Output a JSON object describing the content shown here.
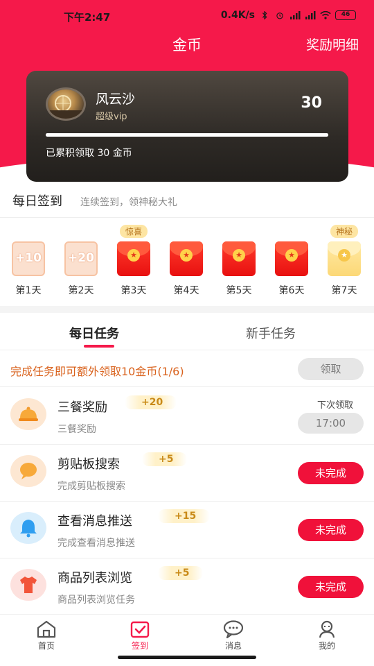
{
  "status_bar": {
    "time": "下午2:47",
    "speed": "0.4K/s",
    "battery": "46"
  },
  "header": {
    "title": "金币",
    "right_link": "奖励明细"
  },
  "user_card": {
    "name": "风云沙",
    "level": "超级vip",
    "coins": "30",
    "progress_fraction": 1.0,
    "accumulated": "已累积领取 30 金币"
  },
  "signin": {
    "title": "每日签到",
    "subtitle": "连续签到，领神秘大礼",
    "days": [
      {
        "label": "第1天",
        "reward": "+10",
        "kind": "claimed",
        "badge": ""
      },
      {
        "label": "第2天",
        "reward": "+20",
        "kind": "claimed",
        "badge": ""
      },
      {
        "label": "第3天",
        "reward": "",
        "kind": "redpack",
        "badge": "惊喜"
      },
      {
        "label": "第4天",
        "reward": "",
        "kind": "redpack",
        "badge": ""
      },
      {
        "label": "第5天",
        "reward": "",
        "kind": "redpack",
        "badge": ""
      },
      {
        "label": "第6天",
        "reward": "",
        "kind": "redpack",
        "badge": ""
      },
      {
        "label": "第7天",
        "reward": "",
        "kind": "goldpack",
        "badge": "神秘"
      }
    ]
  },
  "tabs": [
    {
      "label": "每日任务",
      "active": true
    },
    {
      "label": "新手任务",
      "active": false
    }
  ],
  "bonus": {
    "text": "完成任务即可额外领取10金币(1/6)",
    "button": "领取"
  },
  "tasks": [
    {
      "name": "三餐奖励",
      "reward": "+20",
      "desc": "三餐奖励",
      "next_label": "下次领取",
      "button": "17:00",
      "icon": "food-cover-icon",
      "icon_bg": "#fde7d2"
    },
    {
      "name": "剪贴板搜索",
      "reward": "+5",
      "desc": "完成剪贴板搜索",
      "button": "未完成",
      "icon": "search-bubble-icon",
      "icon_bg": "#fde7d2"
    },
    {
      "name": "查看消息推送",
      "reward": "+15",
      "desc": "完成查看消息推送",
      "button": "未完成",
      "icon": "bell-icon",
      "icon_bg": "#d9eefc"
    },
    {
      "name": "商品列表浏览",
      "reward": "+5",
      "desc": "商品列表浏览任务",
      "button": "未完成",
      "icon": "shirt-icon",
      "icon_bg": "#fde1de"
    }
  ],
  "nav": [
    {
      "label": "首页",
      "icon": "home-icon",
      "active": false
    },
    {
      "label": "签到",
      "icon": "checkin-icon",
      "active": true
    },
    {
      "label": "消息",
      "icon": "message-icon",
      "active": false
    },
    {
      "label": "我的",
      "icon": "profile-icon",
      "active": false
    }
  ],
  "colors": {
    "brand_red": "#f5194a",
    "button_red": "#f0113a",
    "bonus_orange": "#d9621d",
    "reward_gold": "#c98a18"
  }
}
